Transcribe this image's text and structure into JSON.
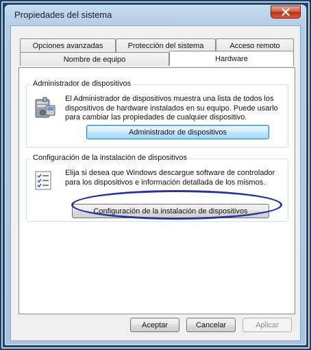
{
  "window": {
    "title": "Propiedades del sistema"
  },
  "tabs_row1": [
    {
      "label": "Opciones avanzadas"
    },
    {
      "label": "Protección del sistema"
    },
    {
      "label": "Acceso remoto"
    }
  ],
  "tabs_row2": [
    {
      "label": "Nombre de equipo"
    },
    {
      "label": "Hardware"
    }
  ],
  "device_manager": {
    "group_label": "Administrador de dispositivos",
    "description": "El Administrador de dispositivos muestra una lista de todos los dispositivos de hardware instalados en su equipo. Puede usarlo para cambiar las propiedades de cualquier dispositivo.",
    "button_label": "Administrador de dispositivos"
  },
  "device_install": {
    "group_label": "Configuración de la instalación de dispositivos",
    "description": "Elija si desea que Windows descargue software de controlador para los dispositivos e información detallada de los mismos.",
    "button_label": "Configuración de la instalación de dispositivos"
  },
  "footer": {
    "ok_label": "Aceptar",
    "cancel_label": "Cancelar",
    "apply_label": "Aplicar"
  },
  "icons": {
    "close": "close-icon",
    "device_manager": "device-manager-icon",
    "checklist": "checklist-icon"
  },
  "colors": {
    "annotation_ellipse": "#24349c",
    "focus_button": "#bee6fd"
  }
}
